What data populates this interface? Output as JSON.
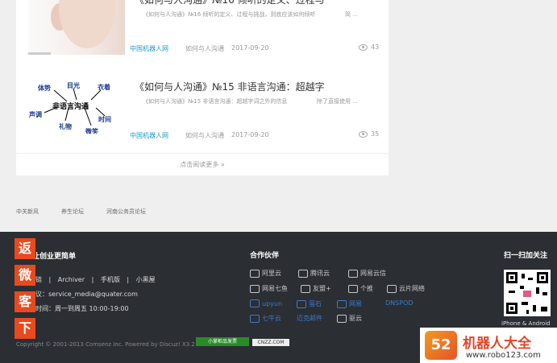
{
  "articles": [
    {
      "title": "《如何与人沟通》№16 倾听的定义、过程与",
      "desc": "《如何与人沟通》№16 倾听的定义、过程与挑战，到底应该如何倾听",
      "desc_tail": "简 ...",
      "category": "中国机器人网",
      "tag": "如何与人沟通",
      "date": "2017-09-20",
      "views": "43"
    },
    {
      "title": "《如何与人沟通》№15 非语言沟通：超越字",
      "desc": "《如何与人沟通》№15 非语言沟通：超越字词之外的信息",
      "desc_tail": "除了直接使用 ...",
      "category": "中国机器人网",
      "tag": "如何与人沟通",
      "date": "2017-09-20",
      "views": "35"
    }
  ],
  "mindmap": {
    "center": "非语言沟通",
    "nodes": [
      "体势",
      "目光",
      "衣着",
      "声调",
      "时间",
      "礼物",
      "微笑"
    ]
  },
  "load_more": "点击阅读更多 »",
  "friend_links": [
    "中关新风",
    "养生论坛",
    "河南公务员论坛"
  ],
  "footer": {
    "about_title": "让创业更简单",
    "about_links": [
      "链",
      "Archiver",
      "手机版",
      "小黑屋"
    ],
    "email": "议：service_media@quater.com",
    "hours": "时间：周一到周五 10:00-19:00",
    "partners_title": "合作伙伴",
    "partners": [
      [
        "阿里云",
        "腾讯云",
        "网易云信"
      ],
      [
        "网易七鱼",
        "友盟+",
        "个推",
        "云片网络"
      ],
      [
        "upyun",
        "萤石",
        "网易",
        "DNSPOD"
      ],
      [
        "七牛云",
        "迈克邮件",
        "驱云"
      ]
    ],
    "scan_title": "扫一扫加关注",
    "scan_caption": "iPhone & Android",
    "copyright": "Copyright © 2001-2013 Comsenz Inc.  Powered by Discuz! X3.2",
    "badge1": "小掌柜品发票",
    "badge2": "CNZZ.COM"
  },
  "side_buttons": [
    "返",
    "微",
    "客",
    "下"
  ],
  "brand": {
    "logo": "52",
    "name": "机器人大全",
    "url": "www.robo123.com"
  }
}
